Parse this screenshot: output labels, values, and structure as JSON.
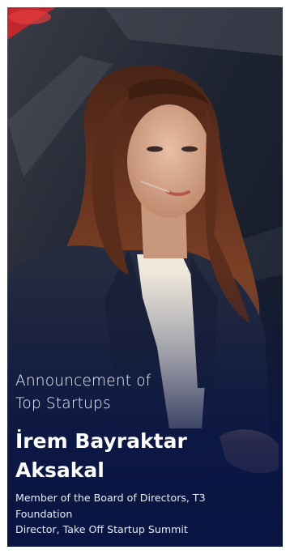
{
  "card": {
    "announcement": "Announcement of Top Startups",
    "name": "İrem Bayraktar Aksakal",
    "roles": [
      "Member of the Board of Directors, T3",
      "Foundation",
      "Director, Take Off Startup Summit"
    ]
  },
  "colors": {
    "overlay": "#0a1848",
    "name_text": "#ffffff",
    "accent_red": "#d8262d"
  },
  "image": {
    "icon": "speaker-photo"
  }
}
